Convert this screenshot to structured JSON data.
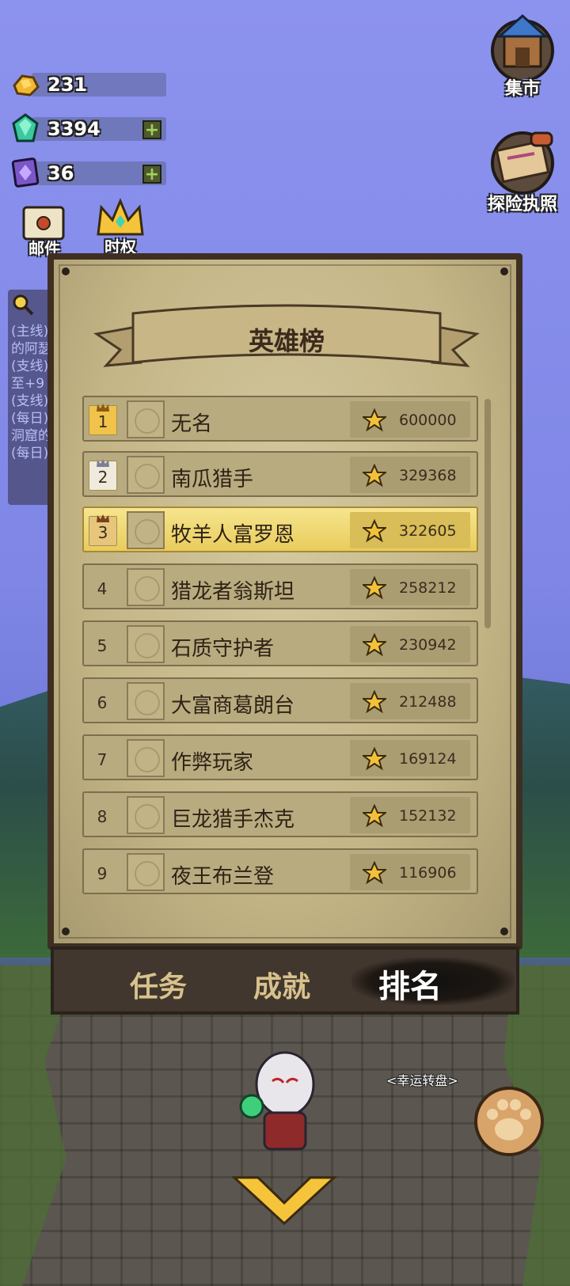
{
  "resources": [
    {
      "icon": "gold-icon",
      "value": "231",
      "has_plus": false
    },
    {
      "icon": "gem-icon",
      "value": "3394",
      "has_plus": true
    },
    {
      "icon": "crystal-card-icon",
      "value": "36",
      "has_plus": true
    }
  ],
  "top_icons": {
    "mail_label": "邮件",
    "mail_icon": "mail-icon",
    "crown_icon": "crown-icon",
    "crown_label": "时权"
  },
  "side_buttons": [
    {
      "label": "集市",
      "icon": "market-icon"
    },
    {
      "label": "探险执照",
      "icon": "license-scroll-icon"
    }
  ],
  "quests": [
    "(主线)的阿瑟",
    "(支线)至+9",
    "(支线)",
    "(每日)洞窟的",
    "(每日)"
  ],
  "panel": {
    "title": "英雄榜",
    "rows": [
      {
        "rank": "1",
        "name": "无名",
        "score": "600000",
        "medal": "gold"
      },
      {
        "rank": "2",
        "name": "南瓜猎手",
        "score": "329368",
        "medal": "silver"
      },
      {
        "rank": "3",
        "name": "牧羊人富罗恩",
        "score": "322605",
        "medal": "bronze"
      },
      {
        "rank": "4",
        "name": "猎龙者翁斯坦",
        "score": "258212",
        "medal": ""
      },
      {
        "rank": "5",
        "name": "石质守护者",
        "score": "230942",
        "medal": ""
      },
      {
        "rank": "6",
        "name": "大富商葛朗台",
        "score": "212488",
        "medal": ""
      },
      {
        "rank": "7",
        "name": "作弊玩家",
        "score": "169124",
        "medal": ""
      },
      {
        "rank": "8",
        "name": "巨龙猎手杰克",
        "score": "152132",
        "medal": ""
      },
      {
        "rank": "9",
        "name": "夜王布兰登",
        "score": "116906",
        "medal": ""
      }
    ],
    "highlight_rank": "3",
    "tabs": [
      {
        "label": "任务",
        "active": false
      },
      {
        "label": "成就",
        "active": false
      },
      {
        "label": "排名",
        "active": true
      }
    ]
  },
  "bottom": {
    "lucky_wheel_label": "<幸运转盘>"
  },
  "colors": {
    "highlight_row": "#f1dc7a",
    "paper": "#c7b98b",
    "frame": "#3e2f22",
    "sky": "#8c93ee"
  }
}
